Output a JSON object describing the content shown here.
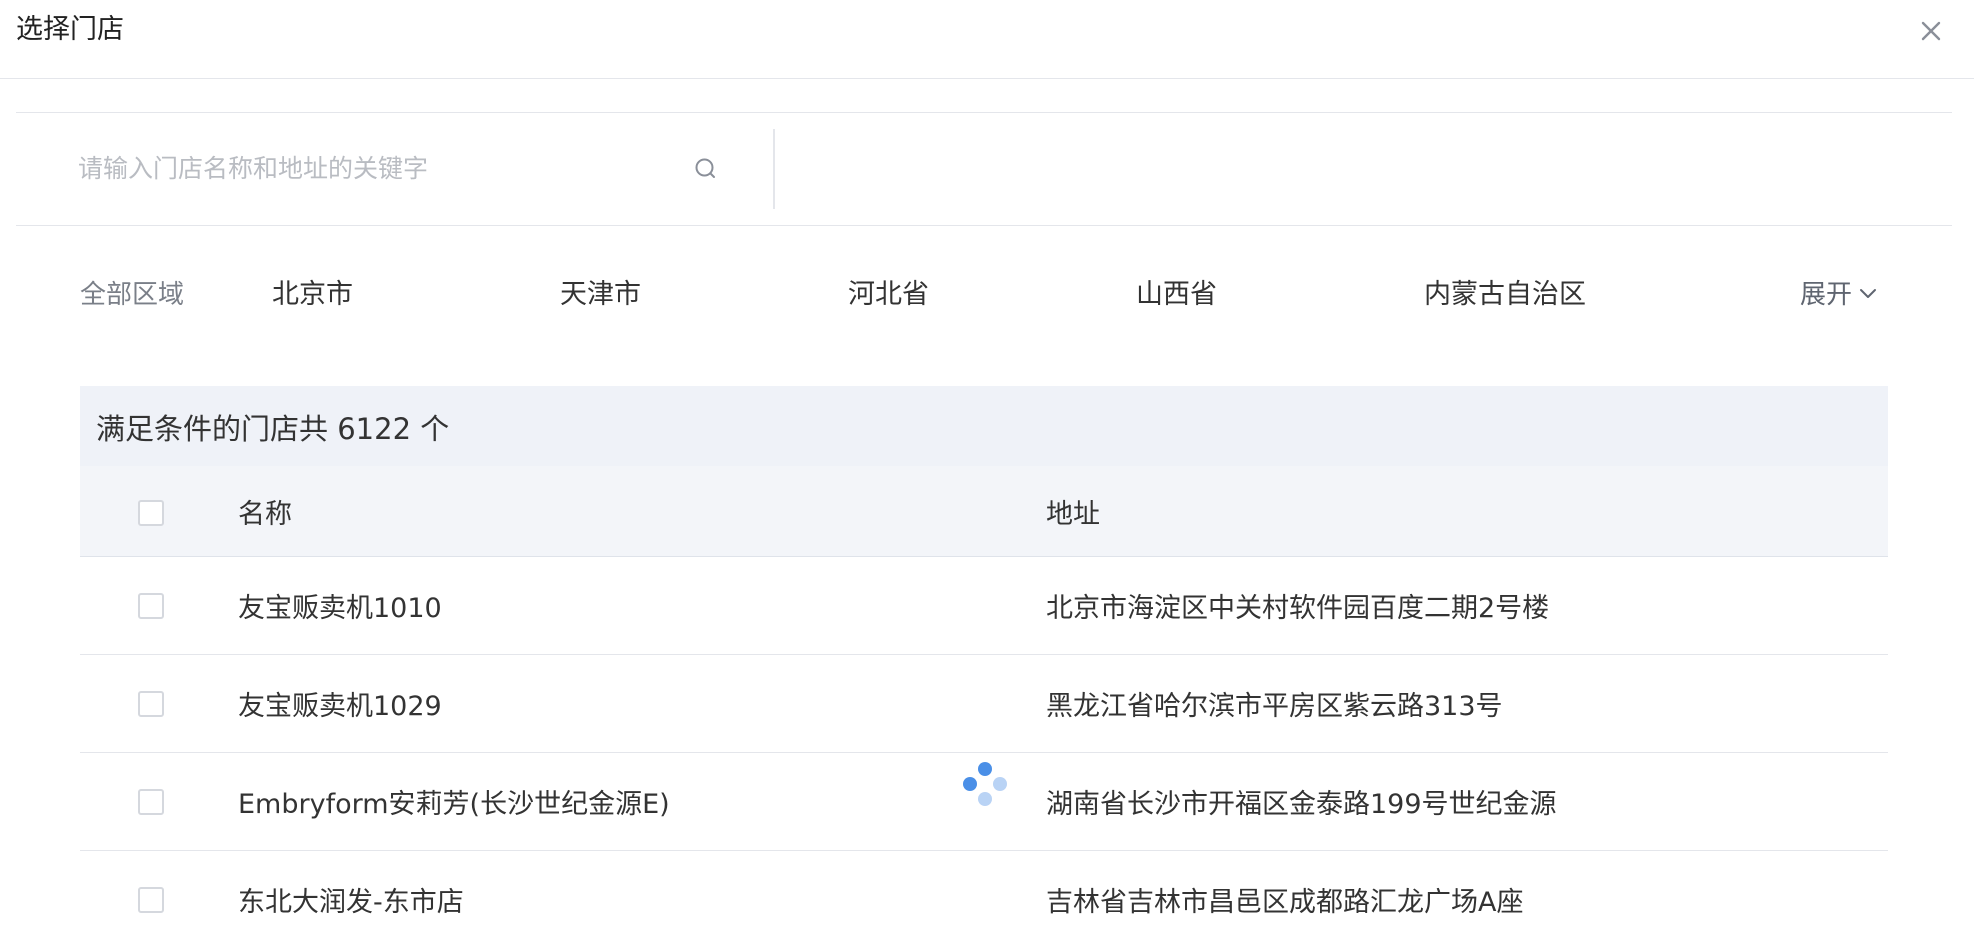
{
  "dialog": {
    "title": "选择门店"
  },
  "search": {
    "placeholder": "请输入门店名称和地址的关键字",
    "value": ""
  },
  "regions": {
    "label": "全部区域",
    "items": [
      "北京市",
      "天津市",
      "河北省",
      "山西省",
      "内蒙古自治区"
    ],
    "expand_label": "展开"
  },
  "result": {
    "count_text": "满足条件的门店共 6122 个"
  },
  "table": {
    "headers": {
      "name": "名称",
      "address": "地址"
    },
    "rows": [
      {
        "name": "友宝贩卖机1010",
        "address": "北京市海淀区中关村软件园百度二期2号楼"
      },
      {
        "name": "友宝贩卖机1029",
        "address": "黑龙江省哈尔滨市平房区紫云路313号"
      },
      {
        "name": "Embryform安莉芳(长沙世纪金源E)",
        "address": "湖南省长沙市开福区金泰路199号世纪金源"
      },
      {
        "name": "东北大润发-东市店",
        "address": "吉林省吉林市昌邑区成都路汇龙广场A座"
      }
    ]
  },
  "colors": {
    "accent": "#4a8fe7",
    "accent_light": "#b9d3f5",
    "header_bg": "#f3f5f9",
    "border": "#e4e6eb"
  }
}
